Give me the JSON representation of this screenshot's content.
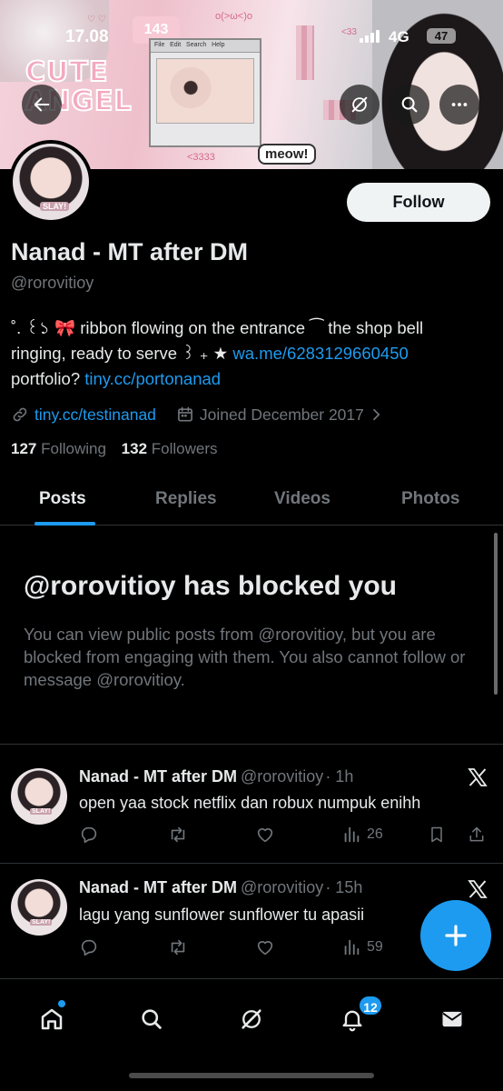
{
  "status_bar": {
    "time": "17.08",
    "network": "4G",
    "battery": "47"
  },
  "banner": {
    "text_cute": "CUTE",
    "text_angel": "ANGEL",
    "text_meow": "meow!",
    "text_tag": "143",
    "text_3333": "<3333",
    "text_33": "<33",
    "text_face": "o(>ω<)o",
    "menu_items": [
      "File",
      "Edit",
      "Search",
      "Help"
    ]
  },
  "profile": {
    "display_name": "Nanad - MT after DM",
    "handle": "@rorovitioy",
    "follow_label": "Follow",
    "avatar_tag": "SLAY!",
    "bio_line1": "˚. ꒰১ 🎀 ribbon flowing on the entrance ⁀ the shop bell",
    "bio_line2_prefix": "ringing, ready to serve ꒱ ₊ ★ ",
    "bio_link1": "wa.me/6283129660450",
    "bio_line3_prefix": "portfolio? ",
    "bio_link2": "tiny.cc/portonanad",
    "website": "tiny.cc/testinanad",
    "joined": "Joined December 2017",
    "following_count": "127",
    "following_label": "Following",
    "followers_count": "132",
    "followers_label": "Followers"
  },
  "tabs": [
    "Posts",
    "Replies",
    "Videos",
    "Photos"
  ],
  "blocked": {
    "title": "@rorovitioy has blocked you",
    "description": "You can view public posts from @rorovitioy, but you are blocked from engaging with them. You also cannot follow or message @rorovitioy."
  },
  "posts": [
    {
      "name": "Nanad - MT after DM",
      "handle": "@rorovitioy",
      "time": "· 1h",
      "text": "open yaa stock netflix dan robux numpuk enihh",
      "views": "26"
    },
    {
      "name": "Nanad - MT after DM",
      "handle": "@rorovitioy",
      "time": "· 15h",
      "text": "lagu yang sunflower sunflower tu apasii",
      "views": "59"
    }
  ],
  "nav": {
    "notification_count": "12",
    "icons": [
      "home-icon",
      "search-icon",
      "grok-icon",
      "bell-icon",
      "mail-icon"
    ]
  },
  "colors": {
    "accent": "#1d9bf0",
    "background": "#000000",
    "secondary_text": "#71767b",
    "primary_text": "#e7e9ea"
  }
}
